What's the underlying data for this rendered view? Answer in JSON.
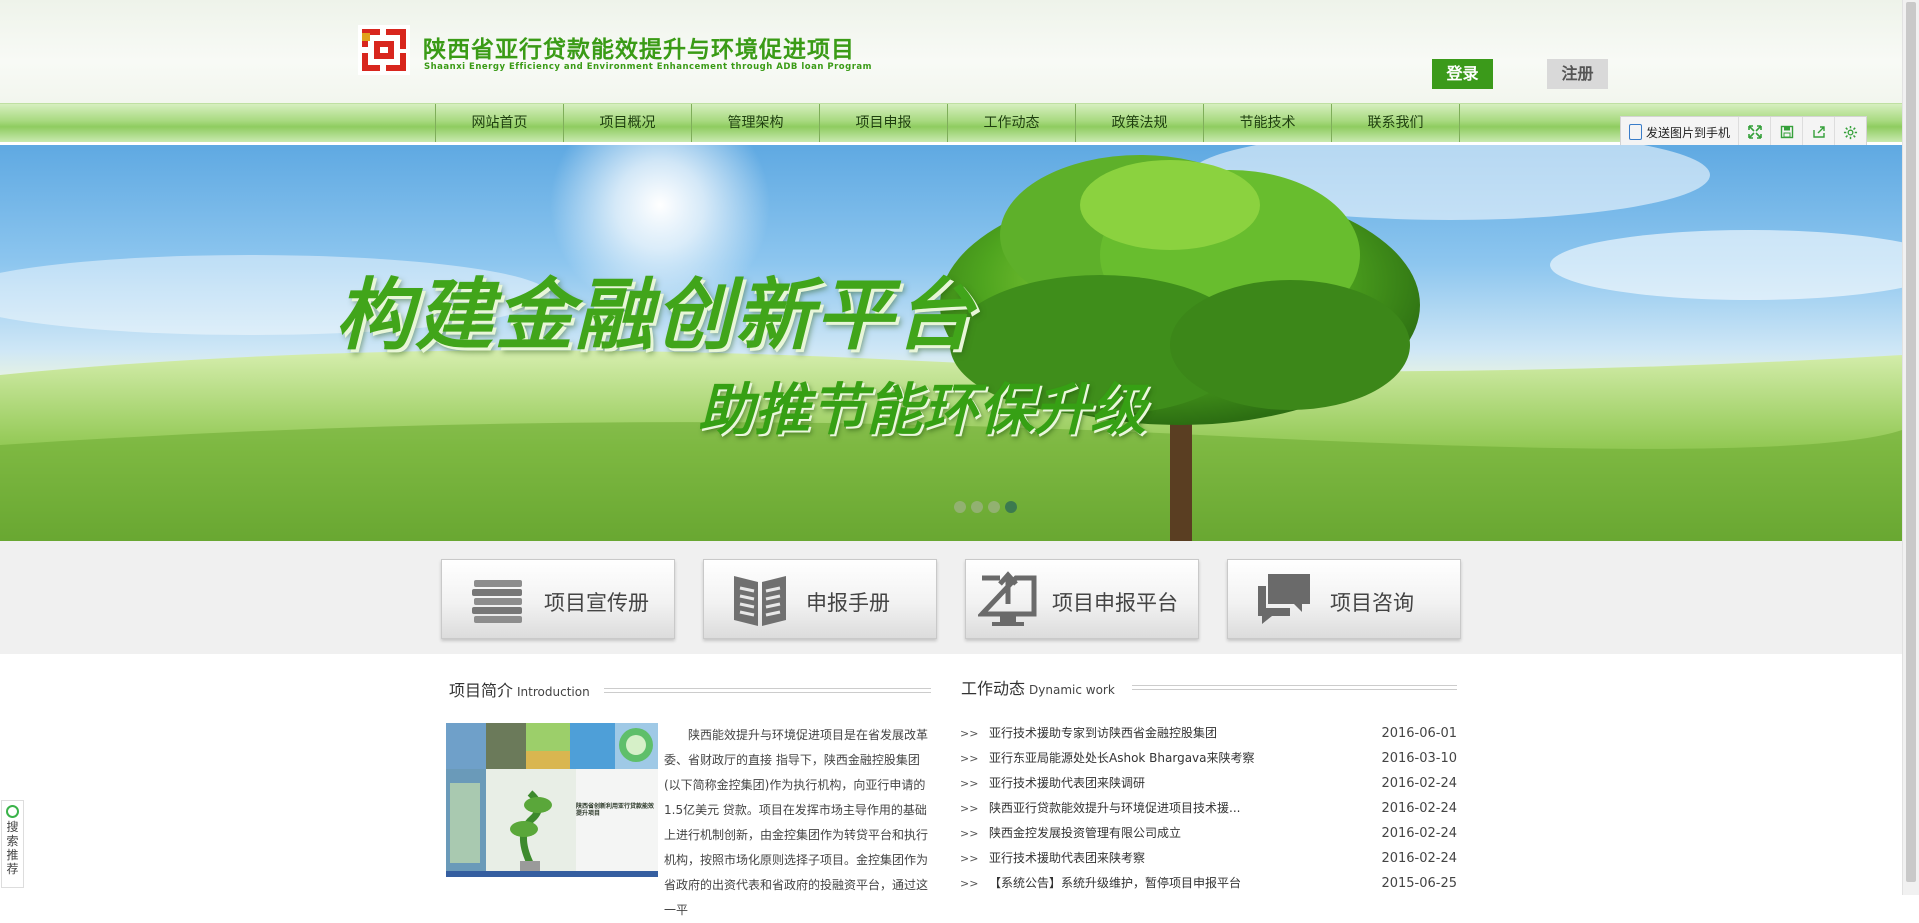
{
  "header": {
    "logo_cn": "陕西省亚行贷款能效提升与环境促进项目",
    "logo_en": "Shaanxi Energy Efficiency and Environment Enhancement through ADB loan Program",
    "login_label": "登录",
    "register_label": "注册"
  },
  "nav": {
    "items": [
      "网站首页",
      "项目概况",
      "管理架构",
      "项目申报",
      "工作动态",
      "政策法规",
      "节能技术",
      "联系我们"
    ]
  },
  "toolbar": {
    "send_label": "发送图片到手机",
    "icons": [
      "fullscreen-icon",
      "save-icon",
      "share-icon",
      "settings-icon"
    ]
  },
  "banner": {
    "headline": "构建金融创新平台",
    "subheadline": "助推节能环保升级",
    "slide_count": 4,
    "active_slide": 4
  },
  "quick_links": [
    {
      "label": "项目宣传册",
      "icon": "brochure-stack-icon"
    },
    {
      "label": "申报手册",
      "icon": "open-book-icon"
    },
    {
      "label": "项目申报平台",
      "icon": "upload-monitor-icon"
    },
    {
      "label": "项目咨询",
      "icon": "chat-bubbles-icon"
    }
  ],
  "intro": {
    "title_cn": "项目简介",
    "title_en": "Introduction",
    "image_caption": "陕西省创新利用亚行贷款能效提升项目",
    "text": "陕西能效提升与环境促进项目是在省发展改革委、省财政厅的直接 指导下，陕西金融控股集团(以下简称金控集团)作为执行机构，向亚行申请的1.5亿美元 贷款。项目在发挥市场主导作用的基础上进行机制创新，由金控集团作为转贷平台和执行机构，按照市场化原则选择子项目。金控集团作为省政府的出资代表和省政府的投融资平台，通过这一平"
  },
  "news": {
    "title_cn": "工作动态",
    "title_en": "Dynamic work",
    "arrow": ">>",
    "items": [
      {
        "title": "亚行技术援助专家到访陕西省金融控股集团",
        "date": "2016-06-01"
      },
      {
        "title": "亚行东亚局能源处处长Ashok Bhargava来陕考察",
        "date": "2016-03-10"
      },
      {
        "title": "亚行技术援助代表团来陕调研",
        "date": "2016-02-24"
      },
      {
        "title": "陕西亚行贷款能效提升与环境促进项目技术援...",
        "date": "2016-02-24"
      },
      {
        "title": "陕西金控发展投资管理有限公司成立",
        "date": "2016-02-24"
      },
      {
        "title": "亚行技术援助代表团来陕考察",
        "date": "2016-02-24"
      },
      {
        "title": "【系统公告】系统升级维护，暂停项目申报平台",
        "date": "2015-06-25"
      }
    ]
  },
  "side_widget": {
    "label": "搜索推荐"
  },
  "colors": {
    "brand_green": "#3b9a1a",
    "logo_red": "#d8261e",
    "logo_gold": "#e0a11b"
  }
}
